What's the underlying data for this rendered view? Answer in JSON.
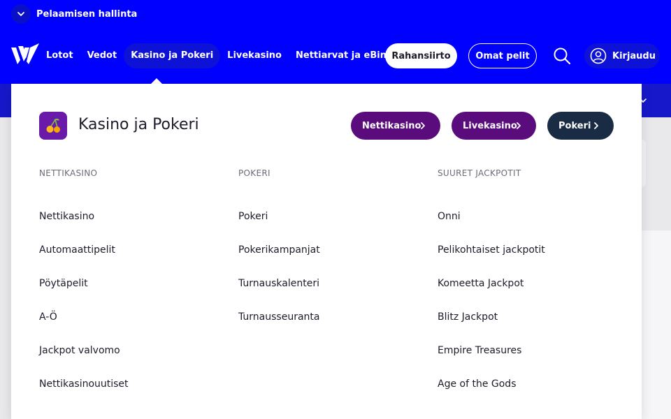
{
  "topbar": {
    "label": "Pelaamisen hallinta"
  },
  "nav": {
    "links": [
      {
        "label": "Lotot"
      },
      {
        "label": "Vedot"
      },
      {
        "label": "Kasino ja Pokeri"
      },
      {
        "label": "Livekasino"
      },
      {
        "label": "Nettiarvat ja eBingo"
      }
    ],
    "transfer_label": "Rahansiirto",
    "my_games_label": "Omat pelit",
    "login_label": "Kirjaudu"
  },
  "menu": {
    "title": "Kasino ja Pokeri",
    "pills": [
      {
        "label": "Nettikasino"
      },
      {
        "label": "Livekasino"
      },
      {
        "label": "Pokeri"
      }
    ],
    "columns": [
      {
        "header": "NETTIKASINO",
        "items": [
          "Nettikasino",
          "Automaattipelit",
          "Pöytäpelit",
          "A-Ö",
          "Jackpot valvomo",
          "Nettikasinouutiset"
        ]
      },
      {
        "header": "POKERI",
        "items": [
          "Pokeri",
          "Pokerikampanjat",
          "Turnauskalenteri",
          "Turnausseuranta"
        ]
      },
      {
        "header": "SUURET JACKPOTIT",
        "items": [
          "Onni",
          "Pelikohtaiset jackpotit",
          "Komeetta Jackpot",
          "Blitz Jackpot",
          "Empire Treasures",
          "Age of the Gods"
        ]
      }
    ]
  },
  "colors": {
    "brand_blue": "#0000ff",
    "pill_purple": "#5a0b7c",
    "pill_dark": "#1a2b44",
    "casino_icon_bg": "#6a1aa8"
  },
  "icons": {
    "topbar_toggle": "chevron-down-icon",
    "logo": "veikkaus-logo-icon",
    "search": "search-icon",
    "login": "user-icon",
    "menu": "cherries-icon",
    "pill": "chevron-right-icon"
  }
}
